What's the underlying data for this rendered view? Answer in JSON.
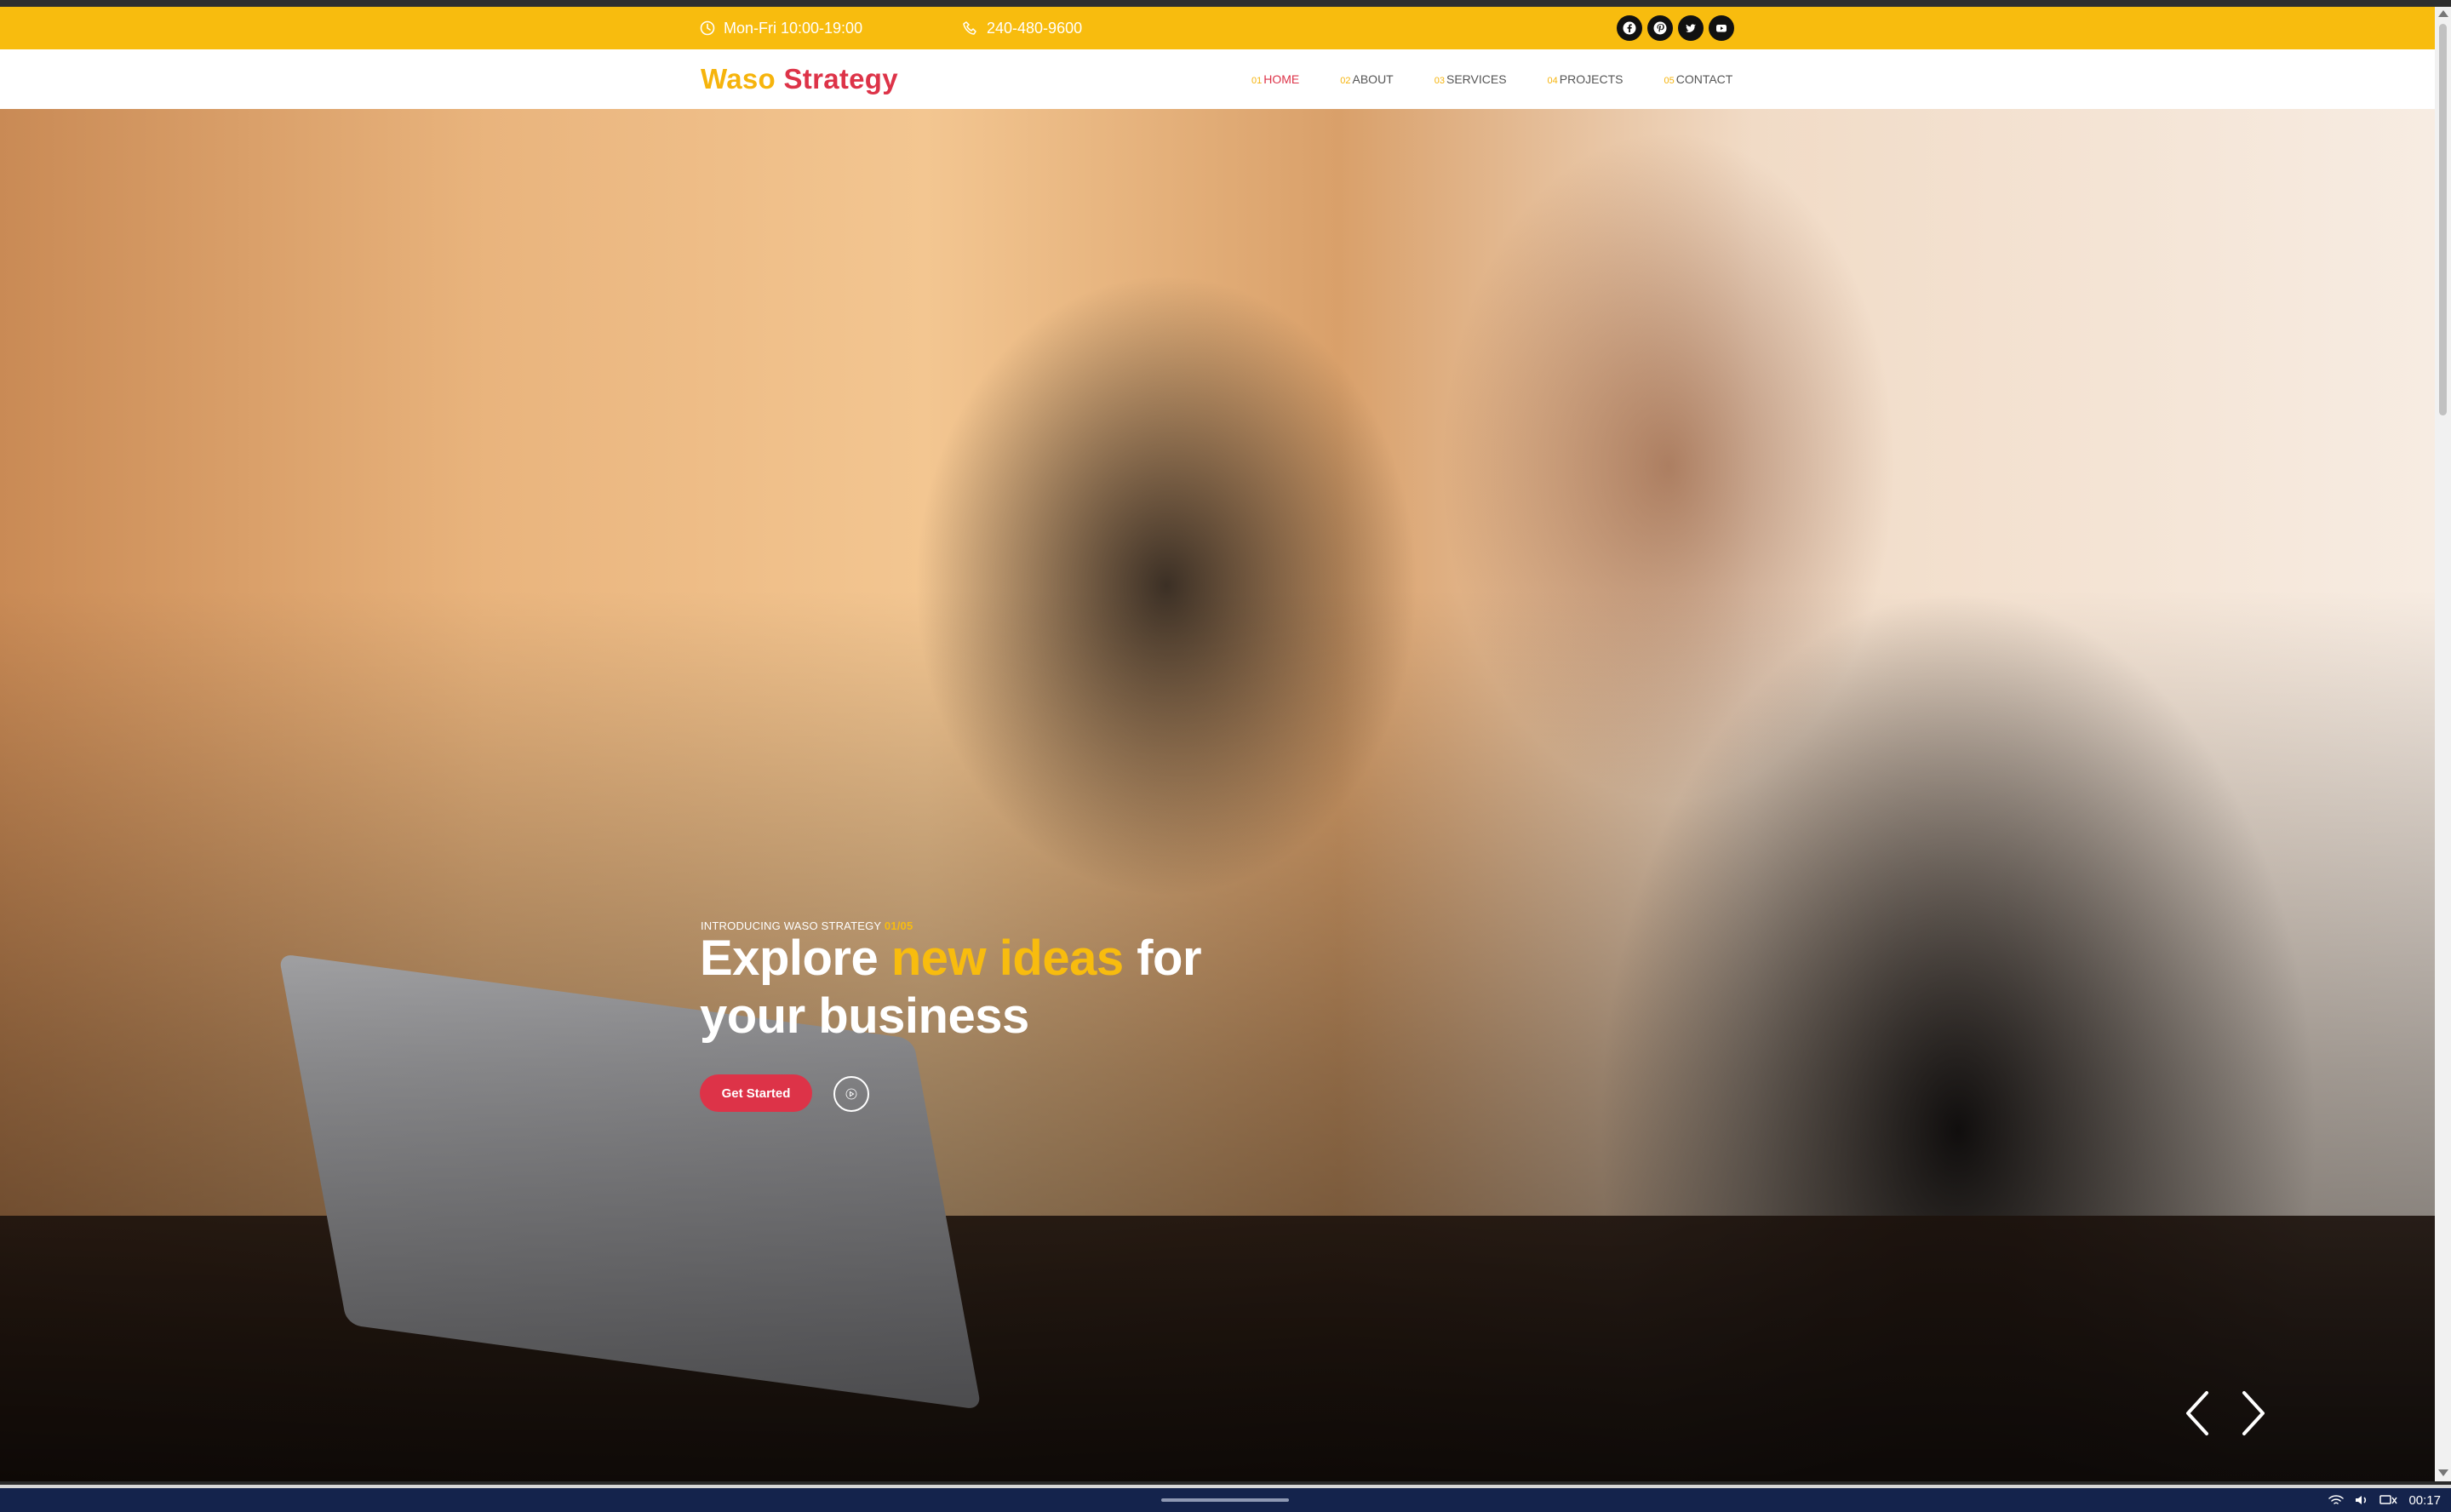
{
  "topbar": {
    "hours": "Mon-Fri 10:00-19:00",
    "phone": "240-480-9600",
    "socials": [
      "facebook-icon",
      "pinterest-icon",
      "twitter-icon",
      "youtube-icon"
    ]
  },
  "brand": {
    "first": "Waso",
    "second": "Strategy",
    "color_primary": "#f6b40c",
    "color_secondary": "#dd3348"
  },
  "nav": [
    {
      "num": "01",
      "label": "HOME",
      "active": true
    },
    {
      "num": "02",
      "label": "ABOUT"
    },
    {
      "num": "03",
      "label": "SERVICES"
    },
    {
      "num": "04",
      "label": "PROJECTS"
    },
    {
      "num": "05",
      "label": "CONTACT"
    }
  ],
  "hero": {
    "eyebrow": "INTRODUCING WASO STRATEGY",
    "counter": "01/05",
    "headline_part1": "Explore",
    "headline_highlight": "new ideas",
    "headline_part2": "for",
    "headline_line2": "your business",
    "cta_label": "Get Started"
  },
  "taskbar": {
    "time": "00:17"
  },
  "colors": {
    "accent_yellow": "#f8bc0e",
    "accent_red": "#dd3348",
    "taskbar": "#14234c"
  }
}
